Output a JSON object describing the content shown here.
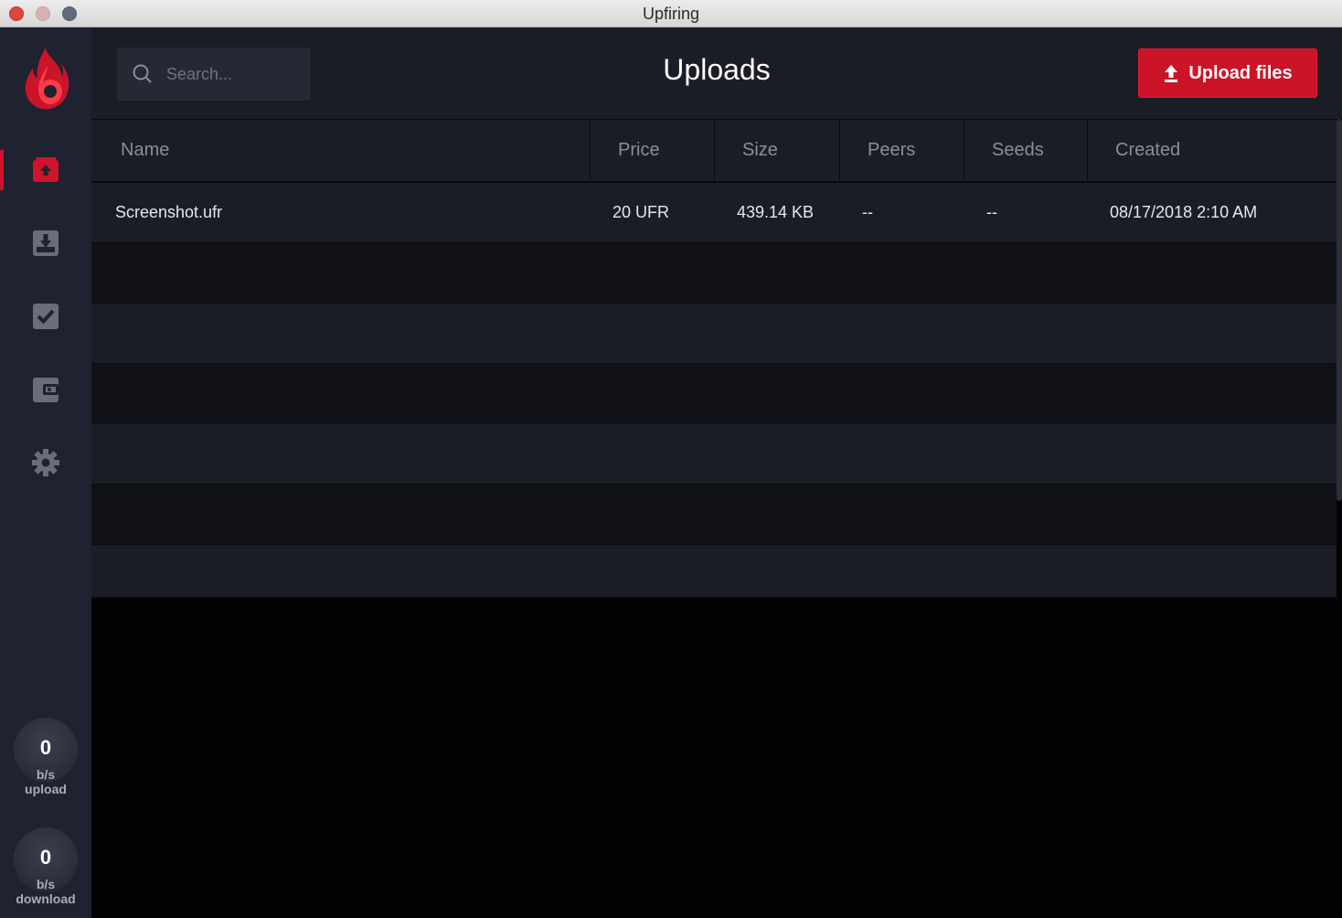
{
  "window": {
    "title": "Upfiring"
  },
  "sidebar": {
    "items": [
      {
        "name": "uploads",
        "icon": "upload-box-icon",
        "active": true
      },
      {
        "name": "downloads",
        "icon": "download-box-icon",
        "active": false
      },
      {
        "name": "completed",
        "icon": "check-box-icon",
        "active": false
      },
      {
        "name": "wallet",
        "icon": "wallet-icon",
        "active": false
      },
      {
        "name": "settings",
        "icon": "gear-icon",
        "active": false
      }
    ],
    "meters": {
      "upload": {
        "value": "0",
        "unit": "b/s",
        "label": "upload"
      },
      "download": {
        "value": "0",
        "unit": "b/s",
        "label": "download"
      }
    }
  },
  "header": {
    "search_placeholder": "Search...",
    "title": "Uploads",
    "upload_button": "Upload files"
  },
  "table": {
    "columns": [
      "Name",
      "Price",
      "Size",
      "Peers",
      "Seeds",
      "Created"
    ],
    "rows": [
      {
        "name": "Screenshot.ufr",
        "price": "20 UFR",
        "size": "439.14 KB",
        "peers": "--",
        "seeds": "--",
        "created": "08/17/2018 2:10 AM"
      }
    ]
  },
  "colors": {
    "accent": "#cc1428",
    "sidebar": "#1f2230",
    "header": "#1b1d26"
  }
}
